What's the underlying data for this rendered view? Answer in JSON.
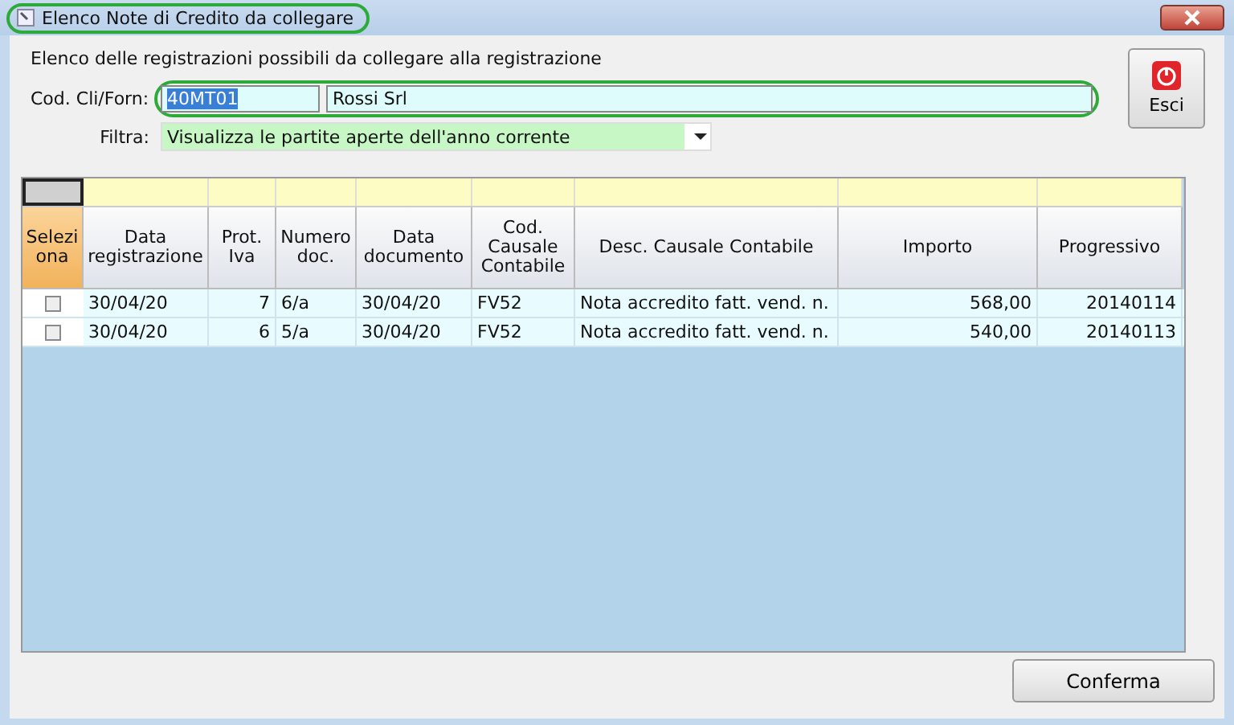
{
  "window": {
    "title": "Elenco Note di Credito da collegare",
    "highlighted": true
  },
  "intro": "Elenco delle registrazioni possibili da collegare alla registrazione",
  "customer": {
    "label": "Cod. Cli/Forn:",
    "code": "40MT01",
    "code_selected": true,
    "name": "Rossi Srl",
    "highlighted": true
  },
  "filter": {
    "label": "Filtra:",
    "value": "Visualizza le partite aperte dell'anno corrente"
  },
  "exit_button": "Esci",
  "table": {
    "columns": [
      "Selezi ona",
      "Data registrazione",
      "Prot. Iva",
      "Numero doc.",
      "Data documento",
      "Cod. Causale Contabile",
      "Desc. Causale Contabile",
      "Importo",
      "Progressivo"
    ],
    "rows": [
      {
        "cells": [
          {
            "kind": "checkbox",
            "checked": false
          },
          "30/04/20",
          "7",
          "6/a",
          "30/04/20",
          "FV52",
          "Nota accredito fatt. vend. n.",
          "568,00",
          "20140114"
        ]
      },
      {
        "cells": [
          {
            "kind": "checkbox",
            "checked": false
          },
          "30/04/20",
          "6",
          "5/a",
          "30/04/20",
          "FV52",
          "Nota accredito fatt. vend. n.",
          "540,00",
          "20140113"
        ]
      }
    ]
  },
  "confirm_button": "Conferma"
}
